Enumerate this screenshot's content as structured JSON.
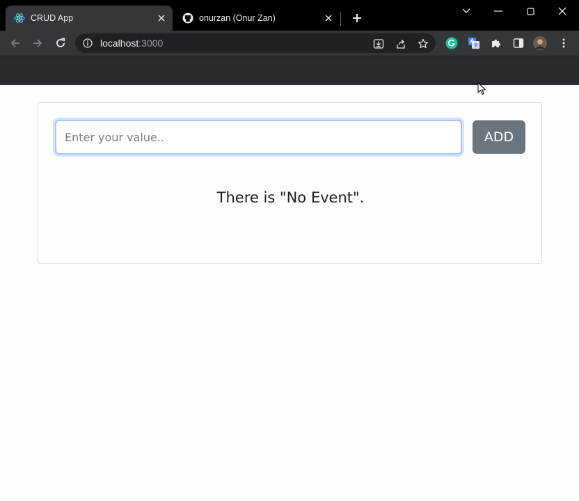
{
  "browser": {
    "tabs": [
      {
        "title": "CRUD App",
        "active": true,
        "icon": "react-icon"
      },
      {
        "title": "onurzan (Onur Zan)",
        "active": false,
        "icon": "github-icon"
      }
    ],
    "address": {
      "host": "localhost",
      "port": ":3000"
    }
  },
  "app": {
    "input_placeholder": "Enter your value..",
    "add_label": "ADD",
    "empty_message": "There is \"No Event\"."
  },
  "colors": {
    "tab_strip": "#000000",
    "toolbar": "#35363a",
    "add_button": "#6c757d",
    "input_focus_border": "#a8c5f5"
  }
}
